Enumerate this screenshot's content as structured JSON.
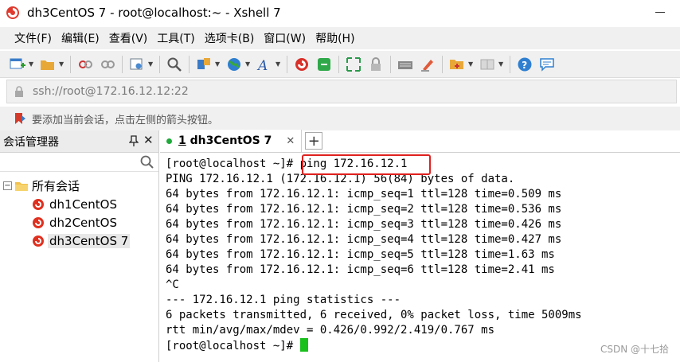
{
  "window": {
    "title": "dh3CentOS 7 - root@localhost:~ - Xshell 7"
  },
  "menu": [
    "文件(F)",
    "编辑(E)",
    "查看(V)",
    "工具(T)",
    "选项卡(B)",
    "窗口(W)",
    "帮助(H)"
  ],
  "toolbar": {
    "icons": [
      "new-session-icon",
      "open-folder-icon",
      "disconnect-icon",
      "reconnect-icon",
      "properties-icon",
      "find-icon",
      "transfer-icon",
      "globe-icon",
      "font-icon",
      "xshell-icon",
      "xftp-icon",
      "fullscreen-icon",
      "lock-icon",
      "keyboard-icon",
      "highlight-icon",
      "compose-icon",
      "layout-icon",
      "help-icon",
      "chat-icon"
    ]
  },
  "address": {
    "value": "ssh://root@172.16.12.12:22"
  },
  "hint": {
    "text": "要添加当前会话，点击左侧的箭头按钮。"
  },
  "session_manager": {
    "title": "会话管理器",
    "root_label": "所有会话",
    "items": [
      {
        "label": "dh1CentOS"
      },
      {
        "label": "dh2CentOS"
      },
      {
        "label": "dh3CentOS 7"
      }
    ]
  },
  "tabs": [
    {
      "number": "1",
      "label": " dh3CentOS 7"
    }
  ],
  "terminal": {
    "lines": [
      "[root@localhost ~]# ping 172.16.12.1",
      "PING 172.16.12.1 (172.16.12.1) 56(84) bytes of data.",
      "64 bytes from 172.16.12.1: icmp_seq=1 ttl=128 time=0.509 ms",
      "64 bytes from 172.16.12.1: icmp_seq=2 ttl=128 time=0.536 ms",
      "64 bytes from 172.16.12.1: icmp_seq=3 ttl=128 time=0.426 ms",
      "64 bytes from 172.16.12.1: icmp_seq=4 ttl=128 time=0.427 ms",
      "64 bytes from 172.16.12.1: icmp_seq=5 ttl=128 time=1.63 ms",
      "64 bytes from 172.16.12.1: icmp_seq=6 ttl=128 time=2.41 ms",
      "^C",
      "--- 172.16.12.1 ping statistics ---",
      "6 packets transmitted, 6 received, 0% packet loss, time 5009ms",
      "rtt min/avg/max/mdev = 0.426/0.992/2.419/0.767 ms"
    ],
    "prompt": "[root@localhost ~]# "
  },
  "watermark": "CSDN @十七拾",
  "colors": {
    "highlight_box": "#e0201e",
    "cursor": "#19c01c",
    "status_dot": "#1faa3a"
  }
}
